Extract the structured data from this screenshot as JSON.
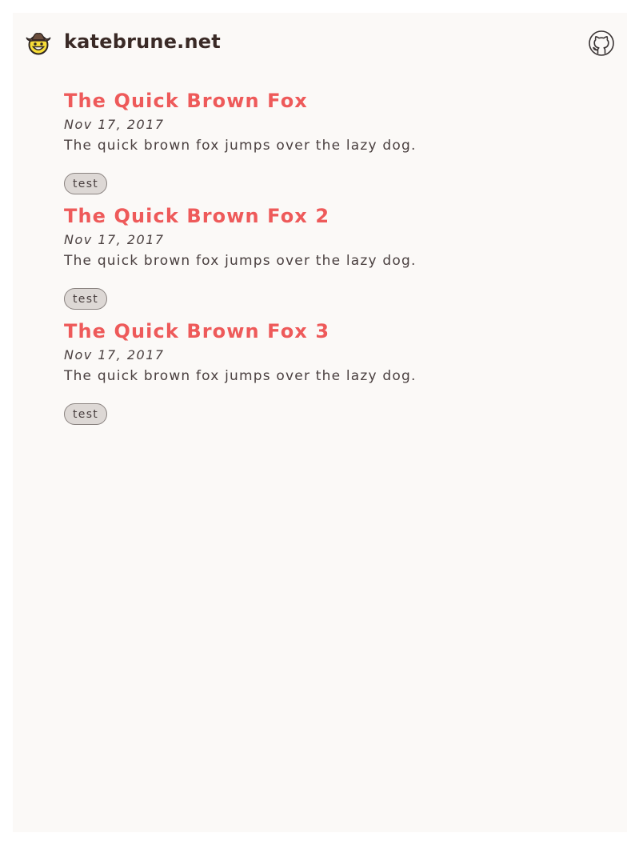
{
  "header": {
    "site_title": "katebrune.net",
    "logo_icon": "cowboy-emoji-icon",
    "github_icon": "github-icon"
  },
  "posts": [
    {
      "title": "The Quick Brown Fox",
      "date": "Nov 17, 2017",
      "excerpt": "The quick brown fox jumps over the lazy dog.",
      "tags": [
        "test"
      ]
    },
    {
      "title": "The Quick Brown Fox 2",
      "date": "Nov 17, 2017",
      "excerpt": "The quick brown fox jumps over the lazy dog.",
      "tags": [
        "test"
      ]
    },
    {
      "title": "The Quick Brown Fox 3",
      "date": "Nov 17, 2017",
      "excerpt": "The quick brown fox jumps over the lazy dog.",
      "tags": [
        "test"
      ]
    }
  ],
  "colors": {
    "accent": "#ee5a5a",
    "text": "#4a4040",
    "background": "#fbf9f7",
    "tag_background": "#ddd8d5"
  }
}
